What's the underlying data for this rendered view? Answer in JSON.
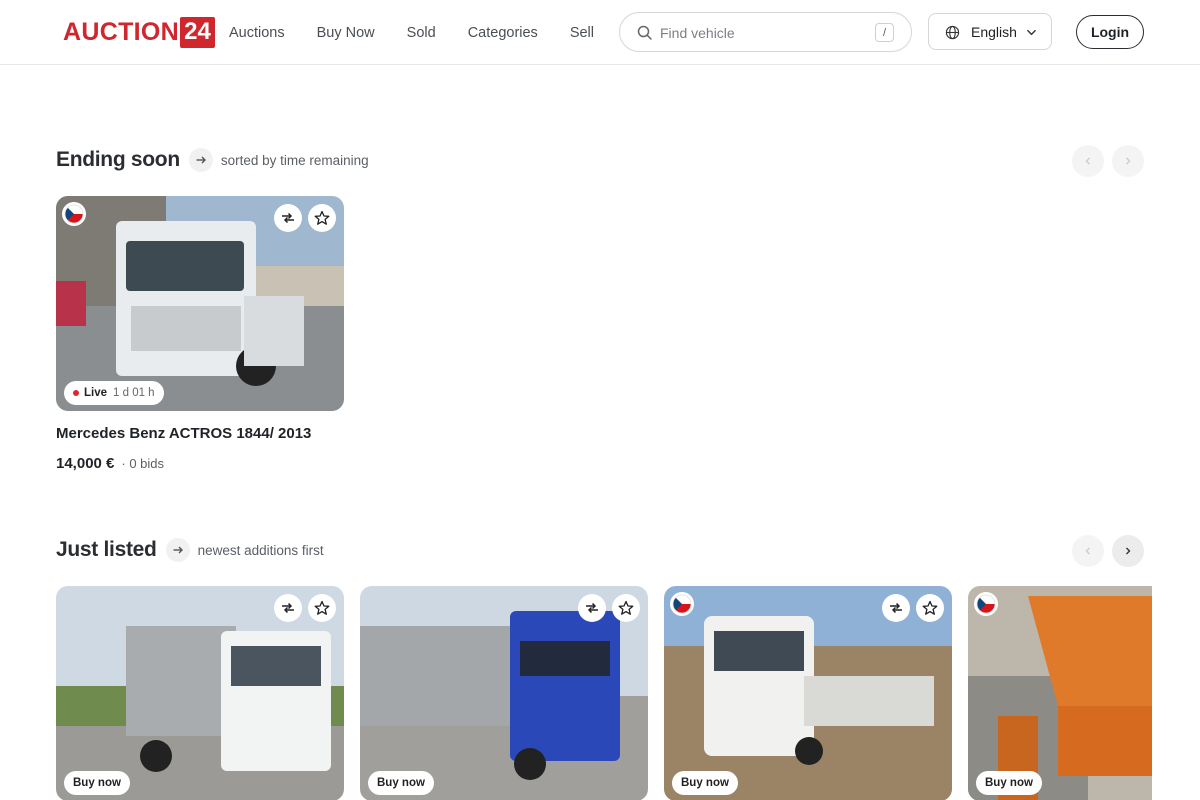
{
  "header": {
    "logo_word": "AUCTION",
    "logo_number": "24",
    "nav": [
      "Auctions",
      "Buy Now",
      "Sold",
      "Categories",
      "Sell"
    ],
    "search_placeholder": "Find vehicle",
    "search_shortcut": "/",
    "language": "English",
    "login_label": "Login"
  },
  "ending_soon": {
    "title": "Ending soon",
    "subtitle": "sorted by time remaining",
    "cards": [
      {
        "title": "Mercedes Benz ACTROS 1844/ 2013",
        "price": "14,000 €",
        "bids": "· 0 bids",
        "status": "Live",
        "time_left": "1 d 01 h",
        "flag": "czech-flag-icon"
      }
    ]
  },
  "just_listed": {
    "title": "Just listed",
    "subtitle": "newest additions first",
    "cards": [
      {
        "badge": "Buy now",
        "flag": null
      },
      {
        "badge": "Buy now",
        "flag": null
      },
      {
        "badge": "Buy now",
        "flag": "czech-flag-icon"
      },
      {
        "badge": "Buy now",
        "flag": "czech-flag-icon"
      }
    ]
  },
  "colors": {
    "brand": "#d0262d",
    "live_dot": "#e0262d",
    "text": "#1f2328"
  }
}
